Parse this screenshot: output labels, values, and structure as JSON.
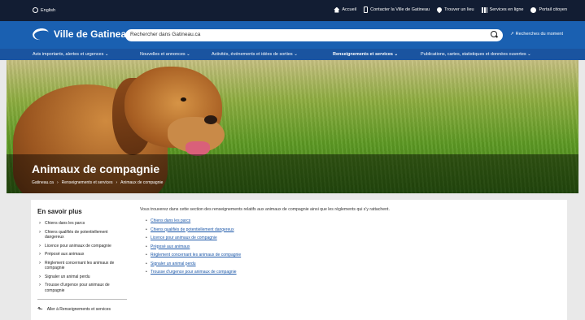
{
  "topbar": {
    "language": "English",
    "links": [
      {
        "label": "Accueil",
        "icon": "home-icon"
      },
      {
        "label": "Contacter la Ville de Gatineau",
        "icon": "phone-icon"
      },
      {
        "label": "Trouver un lieu",
        "icon": "location-pin-icon"
      },
      {
        "label": "Services en ligne",
        "icon": "grid-icon"
      },
      {
        "label": "Portail citoyen",
        "icon": "user-icon"
      }
    ]
  },
  "header": {
    "logo_text": "Ville de Gatineau",
    "search_placeholder": "Rechercher dans Gatineau.ca",
    "trending": "Recherches du moment"
  },
  "nav": [
    {
      "label": "Avis importants, alertes et urgences ⌄"
    },
    {
      "label": "Nouvelles et annonces ⌄"
    },
    {
      "label": "Activités, événements et idées de sorties ⌄"
    },
    {
      "label": "Renseignements et services ⌄"
    },
    {
      "label": "Publications, cartes, statistiques et données ouvertes ⌄"
    }
  ],
  "hero": {
    "title": "Animaux de compagnie",
    "breadcrumb": [
      "Gatineau.ca",
      "›",
      "Renseignements et services",
      "›",
      "Animaux de compagnie"
    ]
  },
  "sidebar": {
    "heading": "En savoir plus",
    "items": [
      "Chiens dans les parcs",
      "Chiens qualifiés de potentiellement dangereux",
      "Licence pour animaux de compagnie",
      "Préposé aux animaux",
      "Règlement concernant les animaux de compagnie",
      "Signaler un animal perdu",
      "Trousse d'urgence pour animaux de compagnie"
    ],
    "back_link": "Aller à Renseignements et services"
  },
  "main": {
    "intro": "Vous trouverez dans cette section des renseignements relatifs aux animaux de compagnie ainsi que les règlements qui s'y rattachent.",
    "links": [
      "Chiens dans les parcs",
      "Chiens qualifiés de potentiellement dangereux",
      "Licence pour animaux de compagnie",
      "Préposé aux animaux",
      "Règlement concernant les animaux de compagnie",
      "Signaler un animal perdu",
      "Trousse d'urgence pour animaux de compagnie"
    ]
  },
  "colors": {
    "topbar": "#121d33",
    "header": "#1a60b1",
    "nav": "#1a54a0",
    "link": "#1a56a8"
  }
}
